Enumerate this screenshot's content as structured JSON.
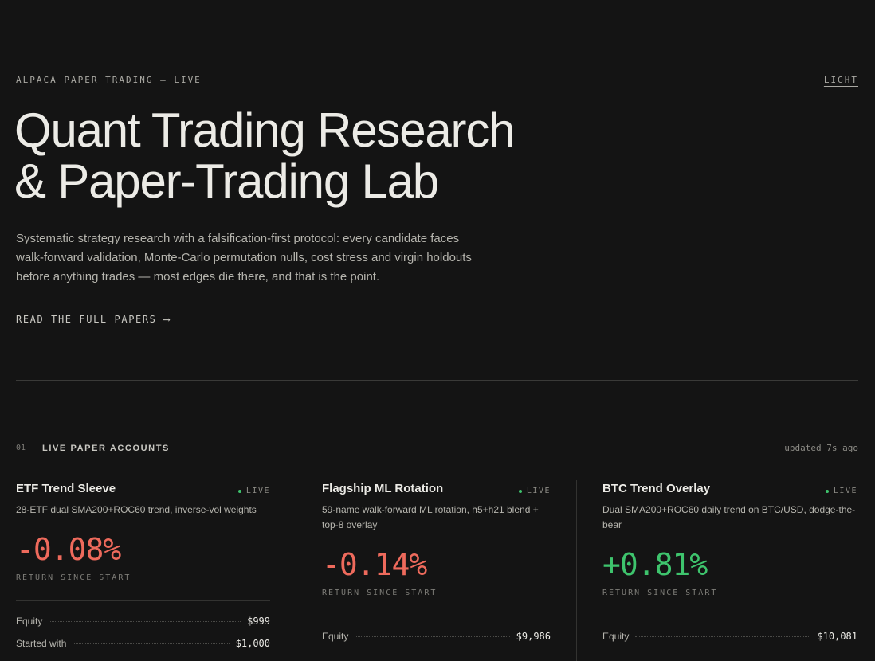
{
  "header": {
    "eyebrow": "ALPACA PAPER TRADING — LIVE",
    "theme_toggle": "LIGHT"
  },
  "hero": {
    "title_line1": "Quant Trading Research",
    "title_line2": "& Paper-Trading Lab",
    "description": "Systematic strategy research with a falsification-first protocol: every candidate faces walk-forward validation, Monte-Carlo permutation nulls, cost stress and virgin holdouts before anything trades — most edges die there, and that is the point.",
    "papers_link": "READ THE FULL PAPERS ⟶"
  },
  "section": {
    "number": "01",
    "title": "LIVE PAPER ACCOUNTS",
    "updated": "updated 7s ago"
  },
  "colors": {
    "background": "#141414",
    "negative": "#ee6a5c",
    "positive": "#3ec46d"
  },
  "accounts": [
    {
      "name": "ETF Trend Sleeve",
      "status": "LIVE",
      "description": "28-ETF dual SMA200+ROC60 trend, inverse-vol weights",
      "return": "-0.08%",
      "return_label": "RETURN SINCE START",
      "equity_label": "Equity",
      "equity": "$999",
      "started_label": "Started with",
      "started": "$1,000"
    },
    {
      "name": "Flagship ML Rotation",
      "status": "LIVE",
      "description": "59-name walk-forward ML rotation, h5+h21 blend + top-8 overlay",
      "return": "-0.14%",
      "return_label": "RETURN SINCE START",
      "equity_label": "Equity",
      "equity": "$9,986"
    },
    {
      "name": "BTC Trend Overlay",
      "status": "LIVE",
      "description": "Dual SMA200+ROC60 daily trend on BTC/USD, dodge-the-bear",
      "return": "+0.81%",
      "return_label": "RETURN SINCE START",
      "equity_label": "Equity",
      "equity": "$10,081"
    }
  ]
}
